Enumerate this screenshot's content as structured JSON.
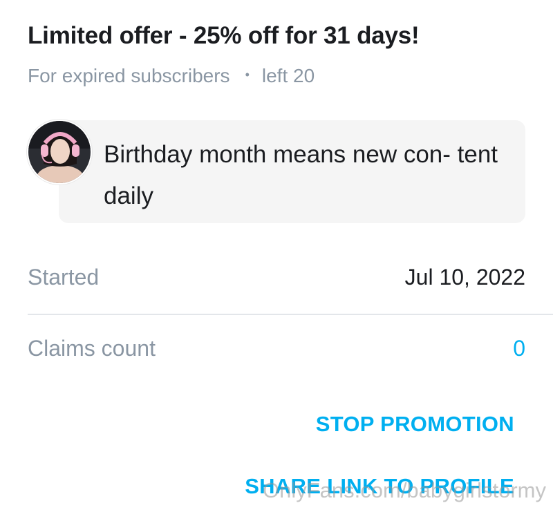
{
  "offer": {
    "title": "Limited offer - 25% off for 31 days!",
    "audience": "For expired subscribers",
    "separator": "•",
    "remaining": "left 20"
  },
  "message": {
    "text": "Birthday month means new con- tent daily",
    "avatar_icon": "profile-photo"
  },
  "details": {
    "started_label": "Started",
    "started_value": "Jul 10, 2022",
    "claims_label": "Claims count",
    "claims_value": "0"
  },
  "actions": {
    "stop_label": "STOP PROMOTION",
    "share_label": "SHARE LINK TO PROFILE"
  },
  "watermark": "OnlyFans.com/babygirlstormy",
  "colors": {
    "accent": "#00aff0",
    "muted": "#8a96a3",
    "text": "#1b1d21",
    "bubble": "#f5f5f5"
  }
}
